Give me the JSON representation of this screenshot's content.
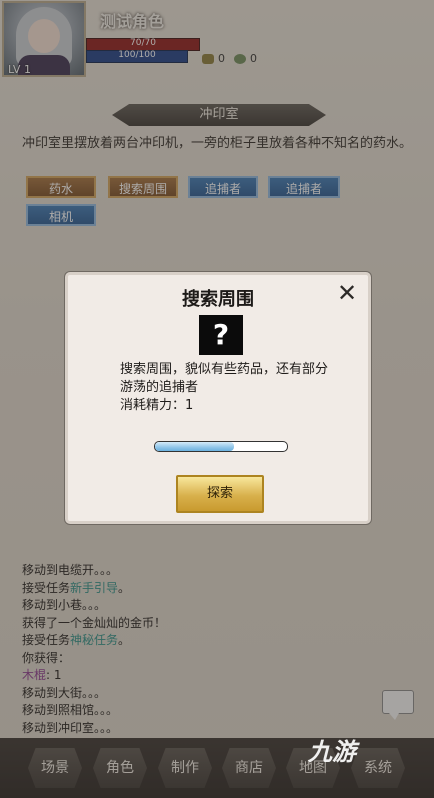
{
  "player": {
    "name": "测试角色",
    "level": "LV 1",
    "hp": "70/70",
    "mp": "100/100",
    "resource1": "0",
    "resource2": "0"
  },
  "location": {
    "title": "冲印室",
    "description": "冲印室里摆放着两台冲印机，一旁的柜子里放着各种不知名的药水。",
    "actions": [
      "药水",
      "搜索周围",
      "追捕者",
      "追捕者",
      "相机"
    ]
  },
  "modal": {
    "title": "搜索周围",
    "close": "✕",
    "question": "?",
    "text": "搜索周围，貌似有些药品，还有部分游荡的追捕者",
    "cost": "消耗精力：1",
    "progress": 0.6,
    "button": "探索"
  },
  "log": [
    {
      "prefix": "移动到电缆开。。。",
      "hl": "",
      "suffix": "",
      "hltype": ""
    },
    {
      "prefix": "接受任务",
      "hl": "新手引导",
      "suffix": "。",
      "hltype": "task"
    },
    {
      "prefix": "移动到小巷。。。",
      "hl": "",
      "suffix": "",
      "hltype": ""
    },
    {
      "prefix": "获得了一个金灿灿的金币！",
      "hl": "",
      "suffix": "",
      "hltype": ""
    },
    {
      "prefix": "接受任务",
      "hl": "神秘任务",
      "suffix": "。",
      "hltype": "task"
    },
    {
      "prefix": "你获得：",
      "hl": "",
      "suffix": "",
      "hltype": ""
    },
    {
      "prefix": "",
      "hl": "木棍",
      "suffix": ": 1",
      "hltype": "item"
    },
    {
      "prefix": "移动到大街。。。",
      "hl": "",
      "suffix": "",
      "hltype": ""
    },
    {
      "prefix": "移动到照相馆。。。",
      "hl": "",
      "suffix": "",
      "hltype": ""
    },
    {
      "prefix": "移动到冲印室。。。",
      "hl": "",
      "suffix": "",
      "hltype": ""
    }
  ],
  "nav": [
    "场景",
    "角色",
    "制作",
    "商店",
    "地图",
    "系统"
  ],
  "watermark": "九游",
  "colors": {
    "hp": "#8e1a1a",
    "mp": "#1e3f86",
    "task": "#2b8e86",
    "item": "#8b3b8e",
    "accent_gold": "#d8b04c"
  }
}
